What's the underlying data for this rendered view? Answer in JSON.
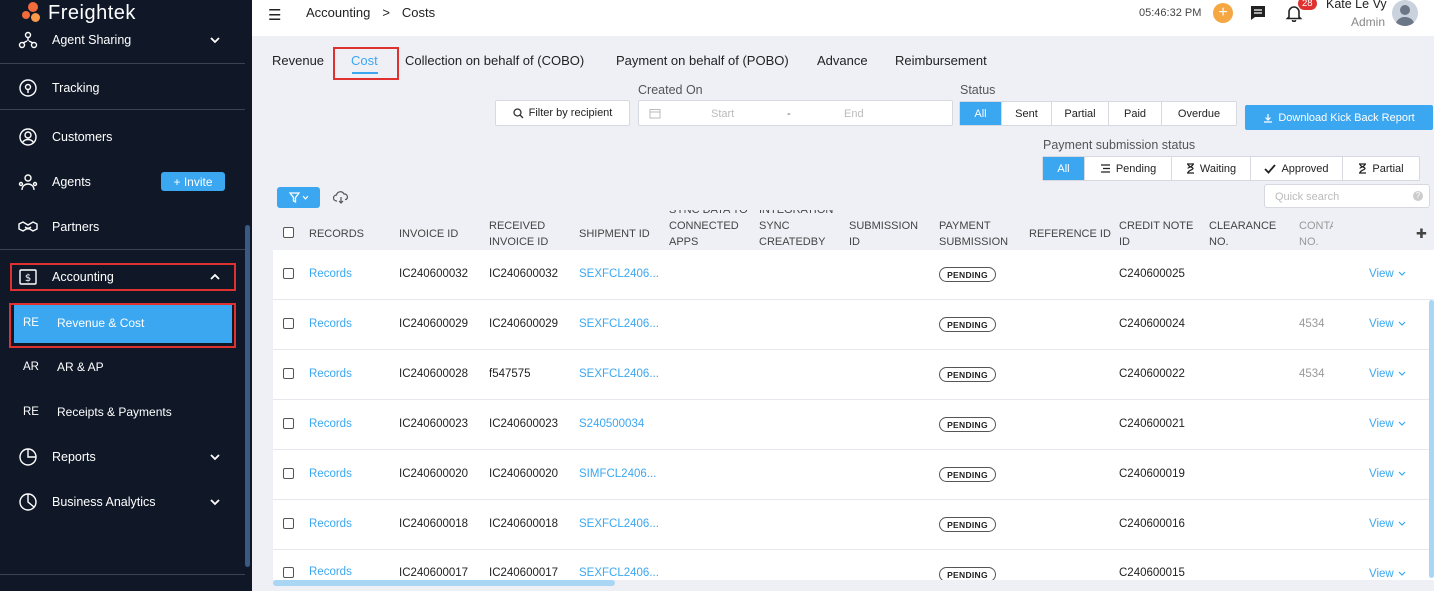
{
  "brand": {
    "name": "Freightek"
  },
  "sidebar": {
    "items": [
      {
        "label": "Agent Sharing",
        "icon": "network-icon"
      },
      {
        "label": "Tracking",
        "icon": "location-pin-icon"
      },
      {
        "label": "Customers",
        "icon": "user-circle-icon"
      },
      {
        "label": "Agents",
        "icon": "agents-icon",
        "action": "+ Invite"
      },
      {
        "label": "Partners",
        "icon": "handshake-icon"
      },
      {
        "label": "Accounting",
        "icon": "dollar-icon"
      },
      {
        "label": "Reports",
        "icon": "pie-chart-icon"
      },
      {
        "label": "Business Analytics",
        "icon": "analytics-icon"
      }
    ],
    "subitems": [
      {
        "abbr": "RE",
        "label": "Revenue & Cost",
        "active": true
      },
      {
        "abbr": "AR",
        "label": "AR & AP"
      },
      {
        "abbr": "RE",
        "label": "Receipts & Payments"
      }
    ]
  },
  "header": {
    "breadcrumb": [
      "Accounting",
      ">",
      "Costs"
    ],
    "time": "05:46:32 PM",
    "notifications": "28",
    "user_name": "Kate Le Vy",
    "user_role": "Admin"
  },
  "tabs": [
    "Revenue",
    "Cost",
    "Collection on behalf of (COBO)",
    "Payment on behalf of (POBO)",
    "Advance",
    "Reimbursement"
  ],
  "filters": {
    "filter_recipient": "Filter by recipient",
    "created_on_label": "Created On",
    "date_start": "Start",
    "date_sep": "-",
    "date_end": "End",
    "status_label": "Status",
    "status_options": [
      "All",
      "Sent",
      "Partial",
      "Paid",
      "Overdue"
    ],
    "download_label": "Download Kick Back Report",
    "payment_status_label": "Payment submission status",
    "payment_status_options": [
      "All",
      "Pending",
      "Waiting",
      "Approved",
      "Partial"
    ],
    "quick_search_placeholder": "Quick search",
    "quick_search_help": "?"
  },
  "table": {
    "headers": [
      "RECORDS",
      "INVOICE ID",
      "RECEIVED INVOICE ID",
      "SHIPMENT ID",
      "SYNC DATA TO CONNECTED APPS",
      "INTEGRATION SYNC CREATEDBY",
      "SUBMISSION ID",
      "PAYMENT SUBMISSION",
      "REFERENCE ID",
      "CREDIT NOTE ID",
      "CLEARANCE NO.",
      "CONTAINER NO."
    ],
    "rows": [
      {
        "records": "Records",
        "invoice_id": "IC240600032",
        "received_invoice_id": "IC240600032",
        "shipment_id": "SEXFCL2406...",
        "payment_submission": "PENDING",
        "credit_note_id": "C240600025",
        "container": "",
        "action": "View"
      },
      {
        "records": "Records",
        "invoice_id": "IC240600029",
        "received_invoice_id": "IC240600029",
        "shipment_id": "SEXFCL2406...",
        "payment_submission": "PENDING",
        "credit_note_id": "C240600024",
        "container": "4534",
        "action": "View"
      },
      {
        "records": "Records",
        "invoice_id": "IC240600028",
        "received_invoice_id": "f547575",
        "shipment_id": "SEXFCL2406...",
        "payment_submission": "PENDING",
        "credit_note_id": "C240600022",
        "container": "4534",
        "action": "View"
      },
      {
        "records": "Records",
        "invoice_id": "IC240600023",
        "received_invoice_id": "IC240600023",
        "shipment_id": "S240500034",
        "payment_submission": "PENDING",
        "credit_note_id": "C240600021",
        "container": "",
        "action": "View"
      },
      {
        "records": "Records",
        "invoice_id": "IC240600020",
        "received_invoice_id": "IC240600020",
        "shipment_id": "SIMFCL2406...",
        "payment_submission": "PENDING",
        "credit_note_id": "C240600019",
        "container": "",
        "action": "View"
      },
      {
        "records": "Records",
        "invoice_id": "IC240600018",
        "received_invoice_id": "IC240600018",
        "shipment_id": "SEXFCL2406...",
        "payment_submission": "PENDING",
        "credit_note_id": "C240600016",
        "container": "",
        "action": "View"
      },
      {
        "records": "Records",
        "invoice_id": "IC240600017",
        "received_invoice_id": "IC240600017",
        "shipment_id": "SEXFCL2406...",
        "payment_submission": "PENDING",
        "credit_note_id": "C240600015",
        "container": "",
        "action": "View"
      }
    ]
  },
  "colors": {
    "accent": "#3ba7f0",
    "sidebar_bg": "#101828",
    "highlight_box": "#e03131",
    "brand_orange": "#f26b3a"
  }
}
